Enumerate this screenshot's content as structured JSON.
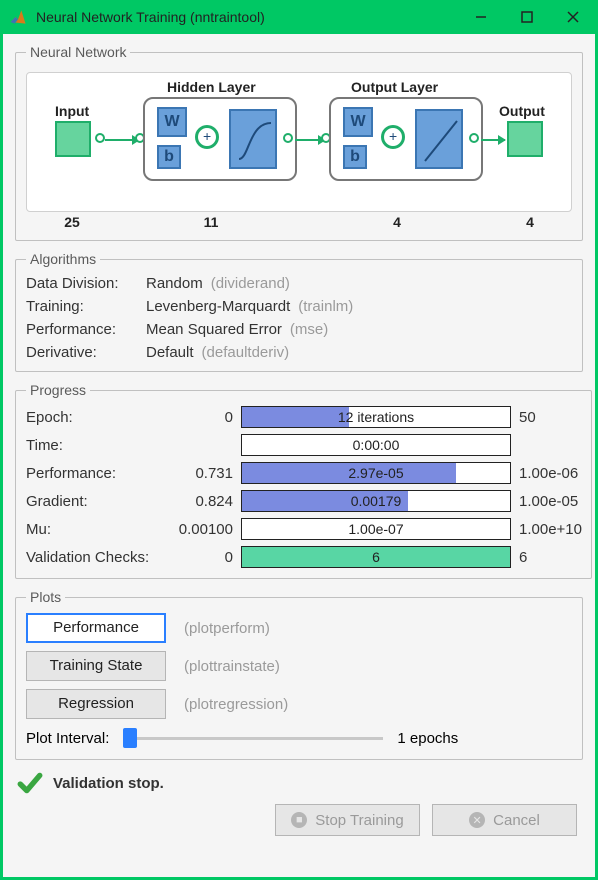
{
  "window": {
    "title": "Neural Network Training (nntraintool)"
  },
  "network": {
    "heading": "Neural Network",
    "input_label": "Input",
    "input_size": "25",
    "hidden_label": "Hidden Layer",
    "hidden_size": "11",
    "output_label": "Output Layer",
    "output_layer_size": "4",
    "output_label2": "Output",
    "output_size": "4",
    "w": "W",
    "b": "b",
    "plus": "+"
  },
  "algorithms": {
    "heading": "Algorithms",
    "rows": [
      {
        "label": "Data Division:",
        "value": "Random",
        "hint": "(dividerand)"
      },
      {
        "label": "Training:",
        "value": "Levenberg-Marquardt",
        "hint": "(trainlm)"
      },
      {
        "label": "Performance:",
        "value": "Mean Squared Error",
        "hint": "(mse)"
      },
      {
        "label": "Derivative:",
        "value": "Default",
        "hint": "(defaultderiv)"
      }
    ]
  },
  "progress": {
    "heading": "Progress",
    "rows": [
      {
        "label": "Epoch:",
        "start": "0",
        "text": "12 iterations",
        "end": "50",
        "fill_pct": 40,
        "green": false
      },
      {
        "label": "Time:",
        "start": "",
        "text": "0:00:00",
        "end": "",
        "fill_pct": 0,
        "green": false
      },
      {
        "label": "Performance:",
        "start": "0.731",
        "text": "2.97e-05",
        "end": "1.00e-06",
        "fill_pct": 80,
        "green": false
      },
      {
        "label": "Gradient:",
        "start": "0.824",
        "text": "0.00179",
        "end": "1.00e-05",
        "fill_pct": 62,
        "green": false
      },
      {
        "label": "Mu:",
        "start": "0.00100",
        "text": "1.00e-07",
        "end": "1.00e+10",
        "fill_pct": 0,
        "green": false
      },
      {
        "label": "Validation Checks:",
        "start": "0",
        "text": "6",
        "end": "6",
        "fill_pct": 100,
        "green": true
      }
    ]
  },
  "plots": {
    "heading": "Plots",
    "buttons": [
      {
        "label": "Performance",
        "hint": "(plotperform)",
        "selected": true
      },
      {
        "label": "Training State",
        "hint": "(plottrainstate)",
        "selected": false
      },
      {
        "label": "Regression",
        "hint": "(plotregression)",
        "selected": false
      }
    ],
    "interval_label": "Plot Interval:",
    "interval_value": "1 epochs"
  },
  "status": {
    "text": "Validation stop."
  },
  "buttons": {
    "stop": "Stop Training",
    "cancel": "Cancel"
  }
}
